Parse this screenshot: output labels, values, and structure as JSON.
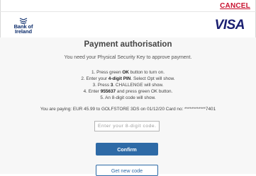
{
  "header": {
    "cancel_label": "CANCEL",
    "bank_name_line1": "Bank of",
    "bank_name_line2": "Ireland",
    "card_brand": "VISA"
  },
  "main": {
    "title": "Payment authorisation",
    "subtitle": "You need your Physical Security Key to approve payment.",
    "steps": [
      {
        "pre": "1. Press green ",
        "bold": "OK",
        "post": " button to turn on."
      },
      {
        "pre": "2. Enter your ",
        "bold": "4-digit PIN",
        "post": ". Select Opt will show."
      },
      {
        "pre": "3. Press ",
        "bold": "3",
        "post": ". CHALLENGE will show."
      },
      {
        "pre": "4. Enter ",
        "bold": "955637",
        "post": " and press green OK button."
      },
      {
        "pre": "5. An 8-digit code will show.",
        "bold": "",
        "post": ""
      }
    ],
    "payment_info": "You are paying: EUR 45.99 to GOLFSTORE 3DS on 01/12/20 Card no: ************7401",
    "code_input": {
      "placeholder": "Enter your 8-digit code.",
      "value": ""
    },
    "confirm_label": "Confirm",
    "new_code_label": "Get new code"
  },
  "colors": {
    "cancel": "#c8102e",
    "bank_blue": "#0d2d6c",
    "visa_blue": "#1a1f71",
    "button_blue": "#2e6aa6"
  }
}
